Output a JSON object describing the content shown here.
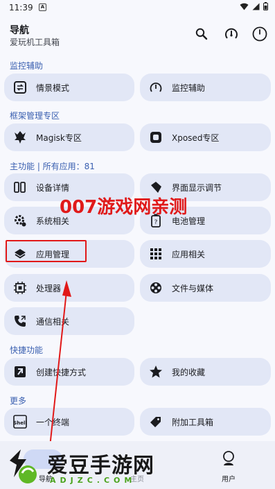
{
  "status_bar": {
    "time": "11:39",
    "notif_letter": "A"
  },
  "header": {
    "title": "导航",
    "subtitle": "爱玩机工具箱"
  },
  "sections": {
    "monitor": {
      "title": "监控辅助",
      "items": [
        "情景模式",
        "监控辅助"
      ]
    },
    "framework": {
      "title": "框架管理专区",
      "items": [
        "Magisk专区",
        "Xposed专区"
      ]
    },
    "main": {
      "title": "主功能 | 所有应用：81",
      "items": [
        "设备详情",
        "界面显示调节",
        "系统相关",
        "电池管理",
        "应用管理",
        "应用相关",
        "处理器",
        "文件与媒体",
        "通信相关"
      ]
    },
    "shortcut": {
      "title": "快捷功能",
      "items": [
        "创建快捷方式",
        "我的收藏"
      ]
    },
    "more": {
      "title": "更多",
      "items": [
        "一个终端",
        "附加工具箱"
      ]
    }
  },
  "watermark_text": "007游戏网亲测",
  "bottom_nav": {
    "items": [
      "导航",
      "主页",
      "用户"
    ]
  },
  "logo_watermark": {
    "name": "爱豆手游网",
    "url": "ADJZC.COM"
  },
  "colors": {
    "accent": "#3a5fb0",
    "card": "#e2e7f6",
    "highlight": "#e11818"
  }
}
